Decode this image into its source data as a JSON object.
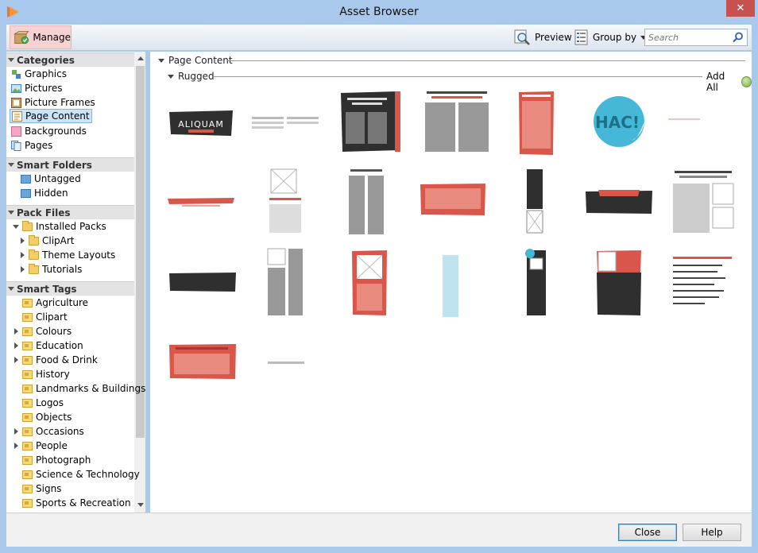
{
  "window": {
    "title": "Asset Browser",
    "close_glyph": "✕"
  },
  "toolbar": {
    "manage_label": "Manage",
    "preview_label": "Preview",
    "groupby_label": "Group by",
    "search_placeholder": "Search"
  },
  "sidebar": {
    "categories": {
      "title": "Categories",
      "items": [
        {
          "label": "Graphics",
          "icon": "graphics-icon"
        },
        {
          "label": "Pictures",
          "icon": "pictures-icon"
        },
        {
          "label": "Picture Frames",
          "icon": "picture-frames-icon"
        },
        {
          "label": "Page Content",
          "icon": "page-content-icon",
          "selected": true
        },
        {
          "label": "Backgrounds",
          "icon": "backgrounds-icon"
        },
        {
          "label": "Pages",
          "icon": "pages-icon"
        }
      ]
    },
    "smart_folders": {
      "title": "Smart Folders",
      "items": [
        {
          "label": "Untagged"
        },
        {
          "label": "Hidden"
        }
      ]
    },
    "pack_files": {
      "title": "Pack Files",
      "root": "Installed Packs",
      "children": [
        {
          "label": "ClipArt"
        },
        {
          "label": "Theme Layouts"
        },
        {
          "label": "Tutorials"
        }
      ]
    },
    "smart_tags": {
      "title": "Smart Tags",
      "items": [
        {
          "label": "Agriculture",
          "expandable": false
        },
        {
          "label": "Clipart",
          "expandable": false
        },
        {
          "label": "Colours",
          "expandable": true
        },
        {
          "label": "Education",
          "expandable": true
        },
        {
          "label": "Food & Drink",
          "expandable": true
        },
        {
          "label": "History",
          "expandable": false
        },
        {
          "label": "Landmarks & Buildings",
          "expandable": false
        },
        {
          "label": "Logos",
          "expandable": false
        },
        {
          "label": "Objects",
          "expandable": false
        },
        {
          "label": "Occasions",
          "expandable": true
        },
        {
          "label": "People",
          "expandable": true
        },
        {
          "label": "Photograph",
          "expandable": false
        },
        {
          "label": "Science & Technology",
          "expandable": false
        },
        {
          "label": "Signs",
          "expandable": false
        },
        {
          "label": "Sports & Recreation",
          "expandable": false
        }
      ]
    }
  },
  "main": {
    "group_title": "Page Content",
    "subgroup_title": "Rugged",
    "add_all_label": "Add All",
    "thumbnails": {
      "aliquam_banner_text": "ALIQUAM",
      "hac_sticker_text": "HAC!"
    }
  },
  "footer": {
    "close_label": "Close",
    "help_label": "Help"
  },
  "colors": {
    "accent_red": "#d9574a",
    "dark_panel": "#2f2f2f",
    "sticker_blue": "#45b8d8"
  }
}
